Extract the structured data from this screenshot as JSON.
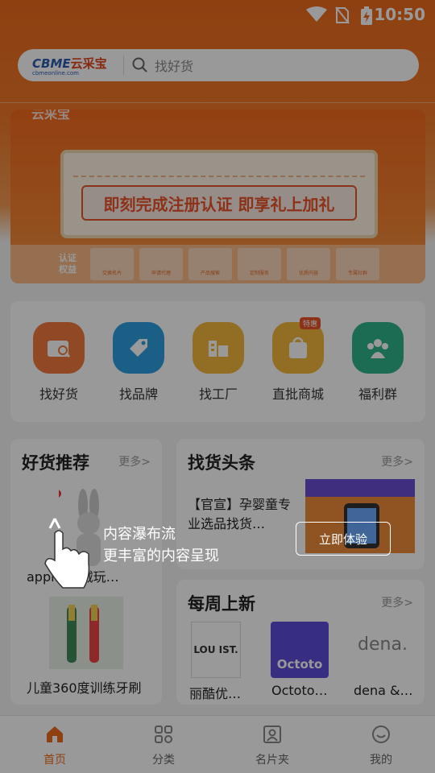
{
  "status_bar": {
    "time": "10:50"
  },
  "search": {
    "brand": "CBME",
    "brand_cn": "云采宝",
    "brand_url": "cbmeonline.com",
    "placeholder": "找好货"
  },
  "banner": {
    "brand_partial": "云采宝",
    "headline": "即刻完成注册认证 即享礼上加礼",
    "strip_label": "认证权益",
    "strip_items": [
      "交换名片",
      "申请代理",
      "产品搜索",
      "定制服务",
      "优质内容",
      "专属社群"
    ]
  },
  "categories": [
    {
      "label": "找好货",
      "icon": "search-shop-icon",
      "color": "#f07a3c"
    },
    {
      "label": "找品牌",
      "icon": "tag-icon",
      "color": "#2f9fe0"
    },
    {
      "label": "找工厂",
      "icon": "factory-icon",
      "color": "#f3b63c"
    },
    {
      "label": "直批商城",
      "icon": "shopping-bag-icon",
      "color": "#f3b63c",
      "badge": "特惠"
    },
    {
      "label": "福利群",
      "icon": "group-icon",
      "color": "#2fb48a"
    }
  ],
  "good_products": {
    "title": "好货推荐",
    "more": "更多>",
    "items": [
      {
        "name": "appl…毛绒玩…"
      },
      {
        "name": "儿童360度训练牙刷"
      }
    ]
  },
  "headlines": {
    "title": "找货头条",
    "more": "更多>",
    "article": "【官宣】孕婴童专业选品找货…"
  },
  "weekly": {
    "title": "每周上新",
    "more": "更多>",
    "items": [
      {
        "name": "丽酷优…",
        "logo_text": "LOU IST."
      },
      {
        "name": "Octoto…",
        "logo_text": "Octoto"
      },
      {
        "name": "dena &…",
        "logo_text": "dena."
      }
    ]
  },
  "guide": {
    "line1": "内容瀑布流",
    "line2": "更丰富的内容呈现",
    "button": "立即体验"
  },
  "tabs": [
    {
      "label": "首页",
      "active": true
    },
    {
      "label": "分类"
    },
    {
      "label": "名片夹"
    },
    {
      "label": "我的"
    }
  ],
  "colors": {
    "accent": "#ee6b1d"
  }
}
